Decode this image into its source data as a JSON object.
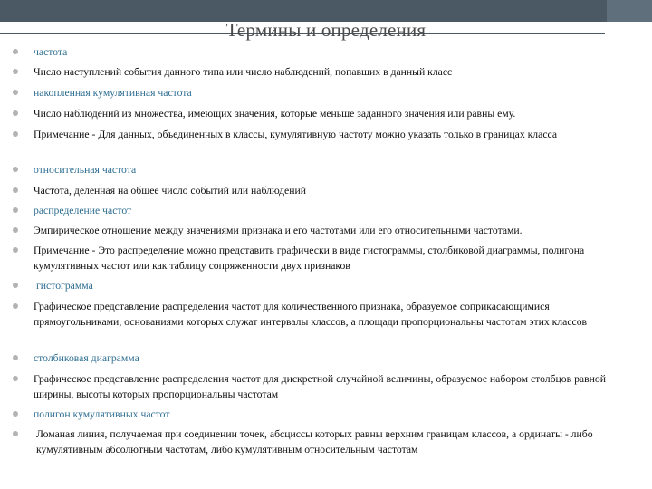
{
  "title": "Термины и определения",
  "items": [
    {
      "text": "частота",
      "kind": "term"
    },
    {
      "text": "Число наступлений события данного типа или число наблюдений, попавших в данный класс",
      "kind": "definition"
    },
    {
      "text": "накопленная кумулятивная частота",
      "kind": "term"
    },
    {
      "text": "Число наблюдений из множества, имеющих значения, которые меньше заданного значения или равны ему.",
      "kind": "definition"
    },
    {
      "text": "Примечание - Для данных, объединенных в классы, кумулятивную частоту можно указать только в границах класса",
      "kind": "definition"
    },
    {
      "text": "относительная частота",
      "kind": "term"
    },
    {
      "text": "Частота, деленная на общее число событий или наблюдений",
      "kind": "definition"
    },
    {
      "text": "распределение частот",
      "kind": "term"
    },
    {
      "text": "Эмпирическое отношение между значениями признака и его частотами или его относительными частотами.",
      "kind": "definition"
    },
    {
      "text": "Примечание - Это распределение можно представить графически в виде гистограммы, столбиковой диаграммы, полигона кумулятивных частот или как таблицу сопряженности двух признаков",
      "kind": "definition"
    },
    {
      "text": "гистограмма",
      "kind": "term"
    },
    {
      "text": "Графическое представление распределения частот для количественного признака, образуемое соприкасающимися прямоугольниками, основаниями которых служат интервалы классов, а площади пропорциональны частотам этих классов",
      "kind": "definition"
    },
    {
      "text": "столбиковая диаграмма",
      "kind": "term"
    },
    {
      "text": "Графическое представление распределения частот для дискретной случайной величины, образуемое набором столбцов равной ширины, высоты которых пропорциональны частотам",
      "kind": "definition"
    },
    {
      "text": "полигон кумулятивных частот",
      "kind": "term"
    },
    {
      "text": "Ломаная линия, получаемая при соединении точек, абсциссы которых равны верхним границам классов, а ординаты - либо кумулятивным абсолютным частотам, либо кумулятивным относительным частотам",
      "kind": "definition"
    }
  ],
  "colors": {
    "topbar": "#4b5965",
    "term": "#2f6f92",
    "text": "#111111",
    "bullet": "#b3b3b3",
    "title": "#4a4a4a"
  }
}
